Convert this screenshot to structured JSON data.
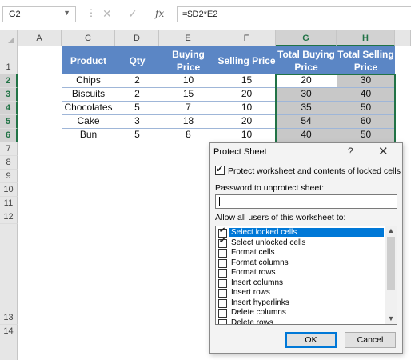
{
  "formula_bar": {
    "name_box": "G2",
    "formula": "=$D2*E2",
    "fx_label": "fx"
  },
  "columns": [
    "A",
    "C",
    "D",
    "E",
    "F",
    "G",
    "H"
  ],
  "rows": [
    "1",
    "2",
    "3",
    "4",
    "5",
    "6",
    "7",
    "8",
    "9",
    "10",
    "11",
    "12",
    "13",
    "14"
  ],
  "table": {
    "headers": [
      "Product",
      "Qty",
      "Buying Price",
      "Selling Price",
      "Total Buying Price",
      "Total Selling Price"
    ],
    "rows": [
      [
        "Chips",
        "2",
        "10",
        "15",
        "20",
        "30"
      ],
      [
        "Biscuits",
        "2",
        "15",
        "20",
        "30",
        "40"
      ],
      [
        "Chocolates",
        "5",
        "7",
        "10",
        "35",
        "50"
      ],
      [
        "Cake",
        "3",
        "18",
        "20",
        "54",
        "60"
      ],
      [
        "Bun",
        "5",
        "8",
        "10",
        "40",
        "50"
      ]
    ]
  },
  "dialog": {
    "title": "Protect Sheet",
    "help": "?",
    "close": "✕",
    "protect_label": "Protect worksheet and contents of locked cells",
    "protect_checked": true,
    "password_label": "Password to unprotect sheet:",
    "password_value": "",
    "allow_label": "Allow all users of this worksheet to:",
    "permissions": [
      {
        "label": "Select locked cells",
        "checked": true
      },
      {
        "label": "Select unlocked cells",
        "checked": true
      },
      {
        "label": "Format cells",
        "checked": false
      },
      {
        "label": "Format columns",
        "checked": false
      },
      {
        "label": "Format rows",
        "checked": false
      },
      {
        "label": "Insert columns",
        "checked": false
      },
      {
        "label": "Insert rows",
        "checked": false
      },
      {
        "label": "Insert hyperlinks",
        "checked": false
      },
      {
        "label": "Delete columns",
        "checked": false
      },
      {
        "label": "Delete rows",
        "checked": false
      }
    ],
    "ok_label": "OK",
    "cancel_label": "Cancel"
  },
  "colors": {
    "header_fill": "#5b86c5",
    "selection": "#217346",
    "highlight": "#0078d7"
  }
}
